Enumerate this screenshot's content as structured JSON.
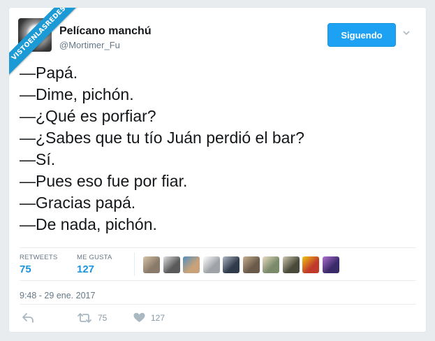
{
  "watermark": {
    "text": "VISTOENLASREDES"
  },
  "user": {
    "name": "Pelícano manchú",
    "handle": "@Mortimer_Fu"
  },
  "follow_button": {
    "label": "Siguendo"
  },
  "tweet": {
    "lines": [
      "—Papá.",
      "—Dime, pichón.",
      "—¿Qué es porfiar?",
      "—¿Sabes que tu tío Juán perdió el bar?",
      "—Sí.",
      "—Pues eso fue por fiar.",
      "—Gracias papá.",
      "—De nada, pichón."
    ],
    "timestamp": "9:48 - 29 ene. 2017"
  },
  "stats": {
    "retweets_label": "RETWEETS",
    "retweets_value": "75",
    "likes_label": "ME GUSTA",
    "likes_value": "127"
  },
  "liker_avatars": [
    {
      "color": "#8a7a6a",
      "accent": "#d8c4a8"
    },
    {
      "color": "#5a5a5a",
      "accent": "#e0e0e0"
    },
    {
      "color": "#c9a27a",
      "accent": "#4f8fbf"
    },
    {
      "color": "#9fa3a8",
      "accent": "#ffffff"
    },
    {
      "color": "#2f3a4a",
      "accent": "#b0b8c4"
    },
    {
      "color": "#6a5a4a",
      "accent": "#c8b090"
    },
    {
      "color": "#7a8a6a",
      "accent": "#e8dcc0"
    },
    {
      "color": "#4a4a3a",
      "accent": "#d0c8b0"
    },
    {
      "color": "#c0392b",
      "accent": "#f1c40f"
    },
    {
      "color": "#3a2a6a",
      "accent": "#b070d0"
    }
  ],
  "actions": {
    "reply_icon": "reply-icon",
    "retweet_icon": "retweet-icon",
    "retweet_count": "75",
    "like_icon": "heart-icon",
    "like_count": "127"
  },
  "colors": {
    "accent": "#1da1f2",
    "ribbon": "#1b9ad6",
    "text": "#14171a",
    "muted": "#657786"
  }
}
